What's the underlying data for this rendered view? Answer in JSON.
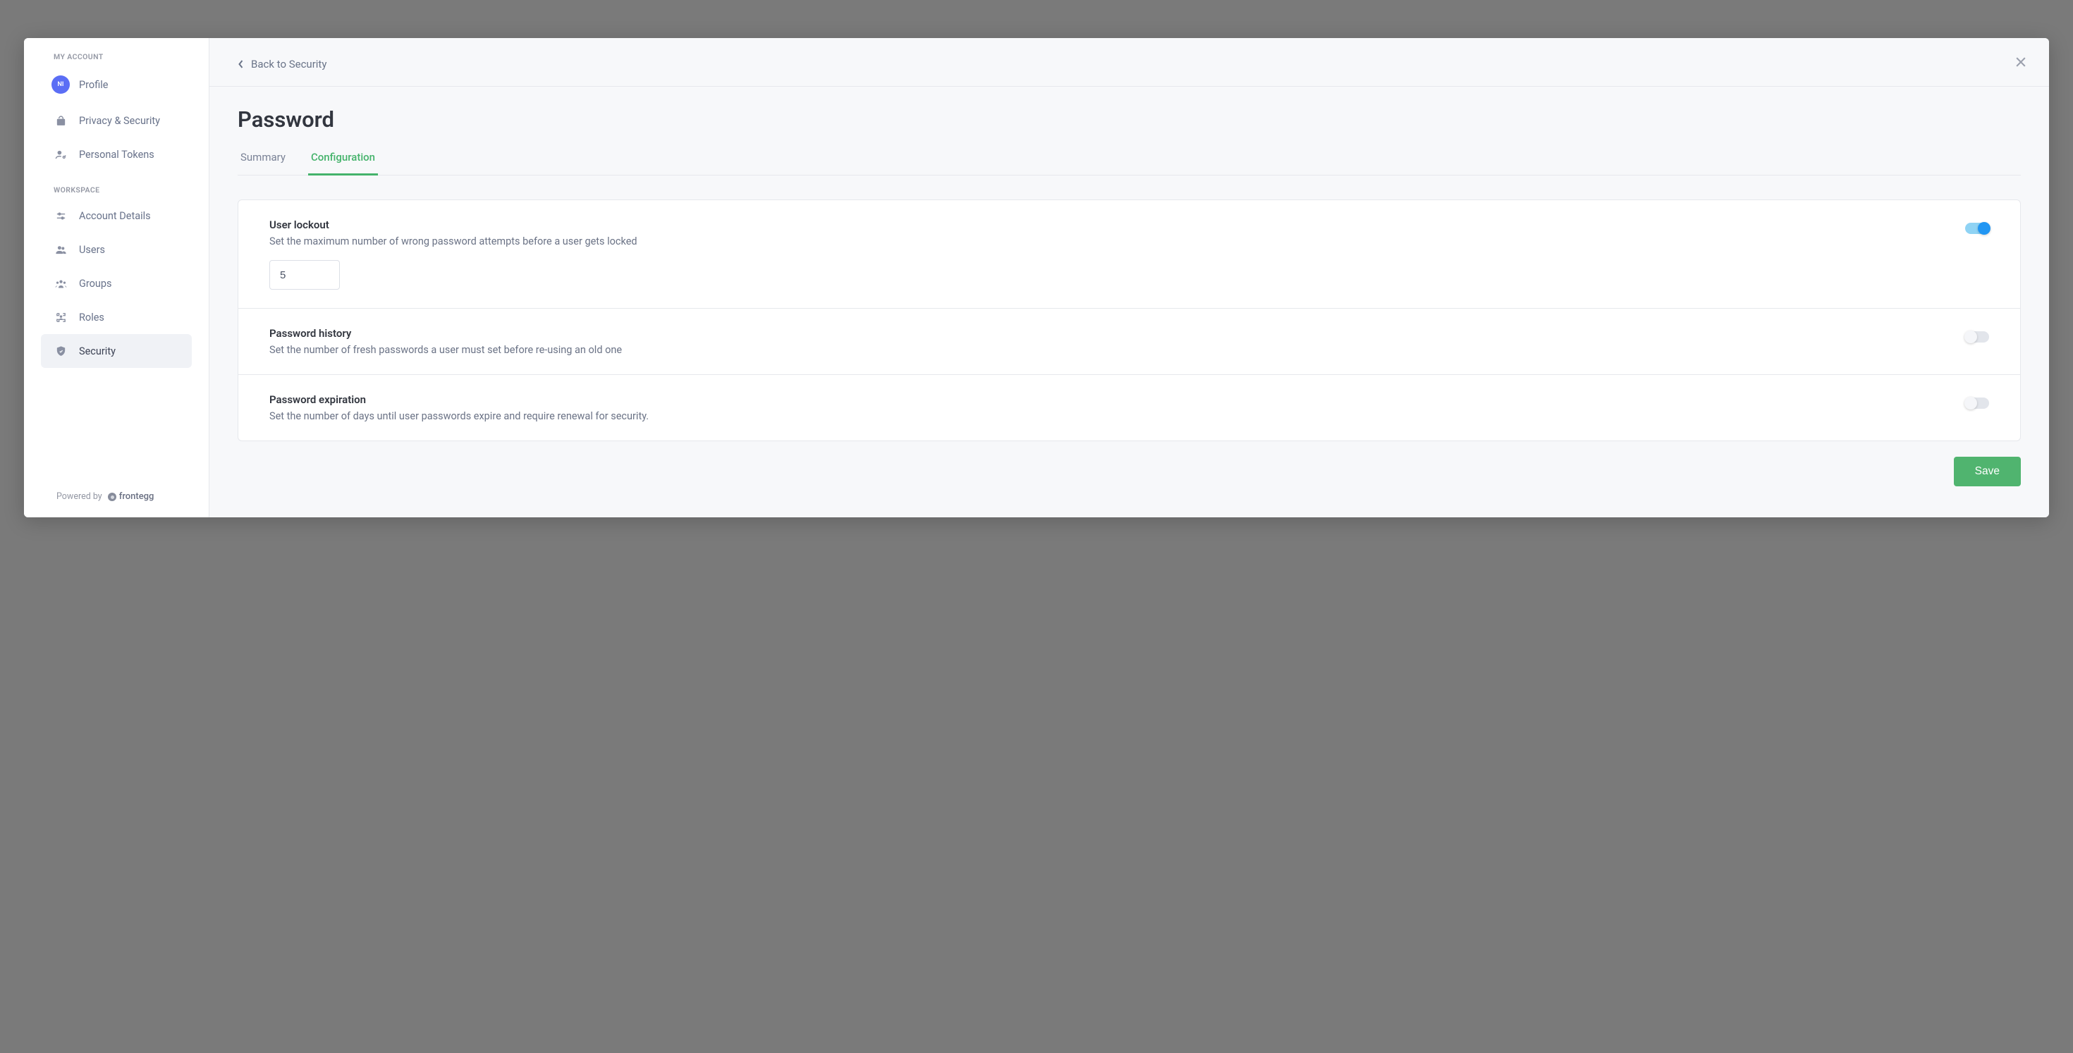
{
  "sidebar": {
    "section_account_label": "MY ACCOUNT",
    "section_workspace_label": "WORKSPACE",
    "avatar_initials": "NI",
    "items_account": [
      {
        "label": "Profile"
      },
      {
        "label": "Privacy & Security"
      },
      {
        "label": "Personal Tokens"
      }
    ],
    "items_workspace": [
      {
        "label": "Account Details"
      },
      {
        "label": "Users"
      },
      {
        "label": "Groups"
      },
      {
        "label": "Roles"
      },
      {
        "label": "Security"
      }
    ],
    "footer_powered_by": "Powered by",
    "footer_brand": "frontegg"
  },
  "header": {
    "back_label": "Back to Security"
  },
  "page": {
    "title": "Password",
    "tabs": {
      "summary": "Summary",
      "configuration": "Configuration"
    }
  },
  "settings": {
    "user_lockout": {
      "title": "User lockout",
      "desc": "Set the maximum number of wrong password attempts before a user gets locked",
      "enabled": true,
      "value": "5"
    },
    "password_history": {
      "title": "Password history",
      "desc": "Set the number of fresh passwords a user must set before re-using an old one",
      "enabled": false
    },
    "password_expiration": {
      "title": "Password expiration",
      "desc": "Set the number of days until user passwords expire and require renewal for security.",
      "enabled": false
    }
  },
  "actions": {
    "save_label": "Save"
  }
}
